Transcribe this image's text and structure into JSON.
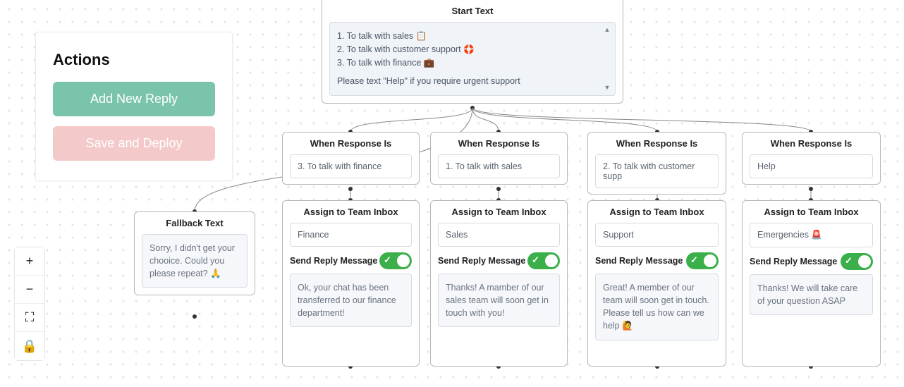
{
  "actions": {
    "title": "Actions",
    "add_reply": "Add New Reply",
    "save_deploy": "Save and Deploy"
  },
  "toolbox": {
    "zoom_in": "+",
    "zoom_out": "−",
    "fullscreen": "⛶",
    "lock": "🔒"
  },
  "flow": {
    "start": {
      "title": "Start Text",
      "line1": "1. To talk with sales 📋",
      "line2": "2. To talk with customer support 🛟",
      "line3": "3. To talk with finance 💼",
      "line4": "Please text \"Help\" if you require urgent support"
    },
    "fallback": {
      "title": "Fallback Text",
      "text": "Sorry, I didn't get your chooice. Could you please repeat? 🙏"
    },
    "responses": [
      {
        "title": "When Response Is",
        "value": "3. To talk with finance"
      },
      {
        "title": "When Response Is",
        "value": "1. To talk with sales"
      },
      {
        "title": "When Response Is",
        "value": "2. To talk with customer supp"
      },
      {
        "title": "When Response Is",
        "value": "Help"
      }
    ],
    "assigns": [
      {
        "title": "Assign to Team Inbox",
        "team": "Finance",
        "toggle_label": "Send Reply Message",
        "reply": "Ok, your chat has been transferred to our finance department!"
      },
      {
        "title": "Assign to Team Inbox",
        "team": "Sales",
        "toggle_label": "Send Reply Message",
        "reply": "Thanks! A mamber of our sales team will soon get in touch with you!"
      },
      {
        "title": "Assign to Team Inbox",
        "team": "Support",
        "toggle_label": "Send Reply Message",
        "reply": "Great! A member of our team will soon get in touch. Please tell us how can we help 🙋"
      },
      {
        "title": "Assign to Team Inbox",
        "team": "Emergencies 🚨",
        "toggle_label": "Send Reply Message",
        "reply": "Thanks! We will take care of your question ASAP"
      }
    ]
  }
}
